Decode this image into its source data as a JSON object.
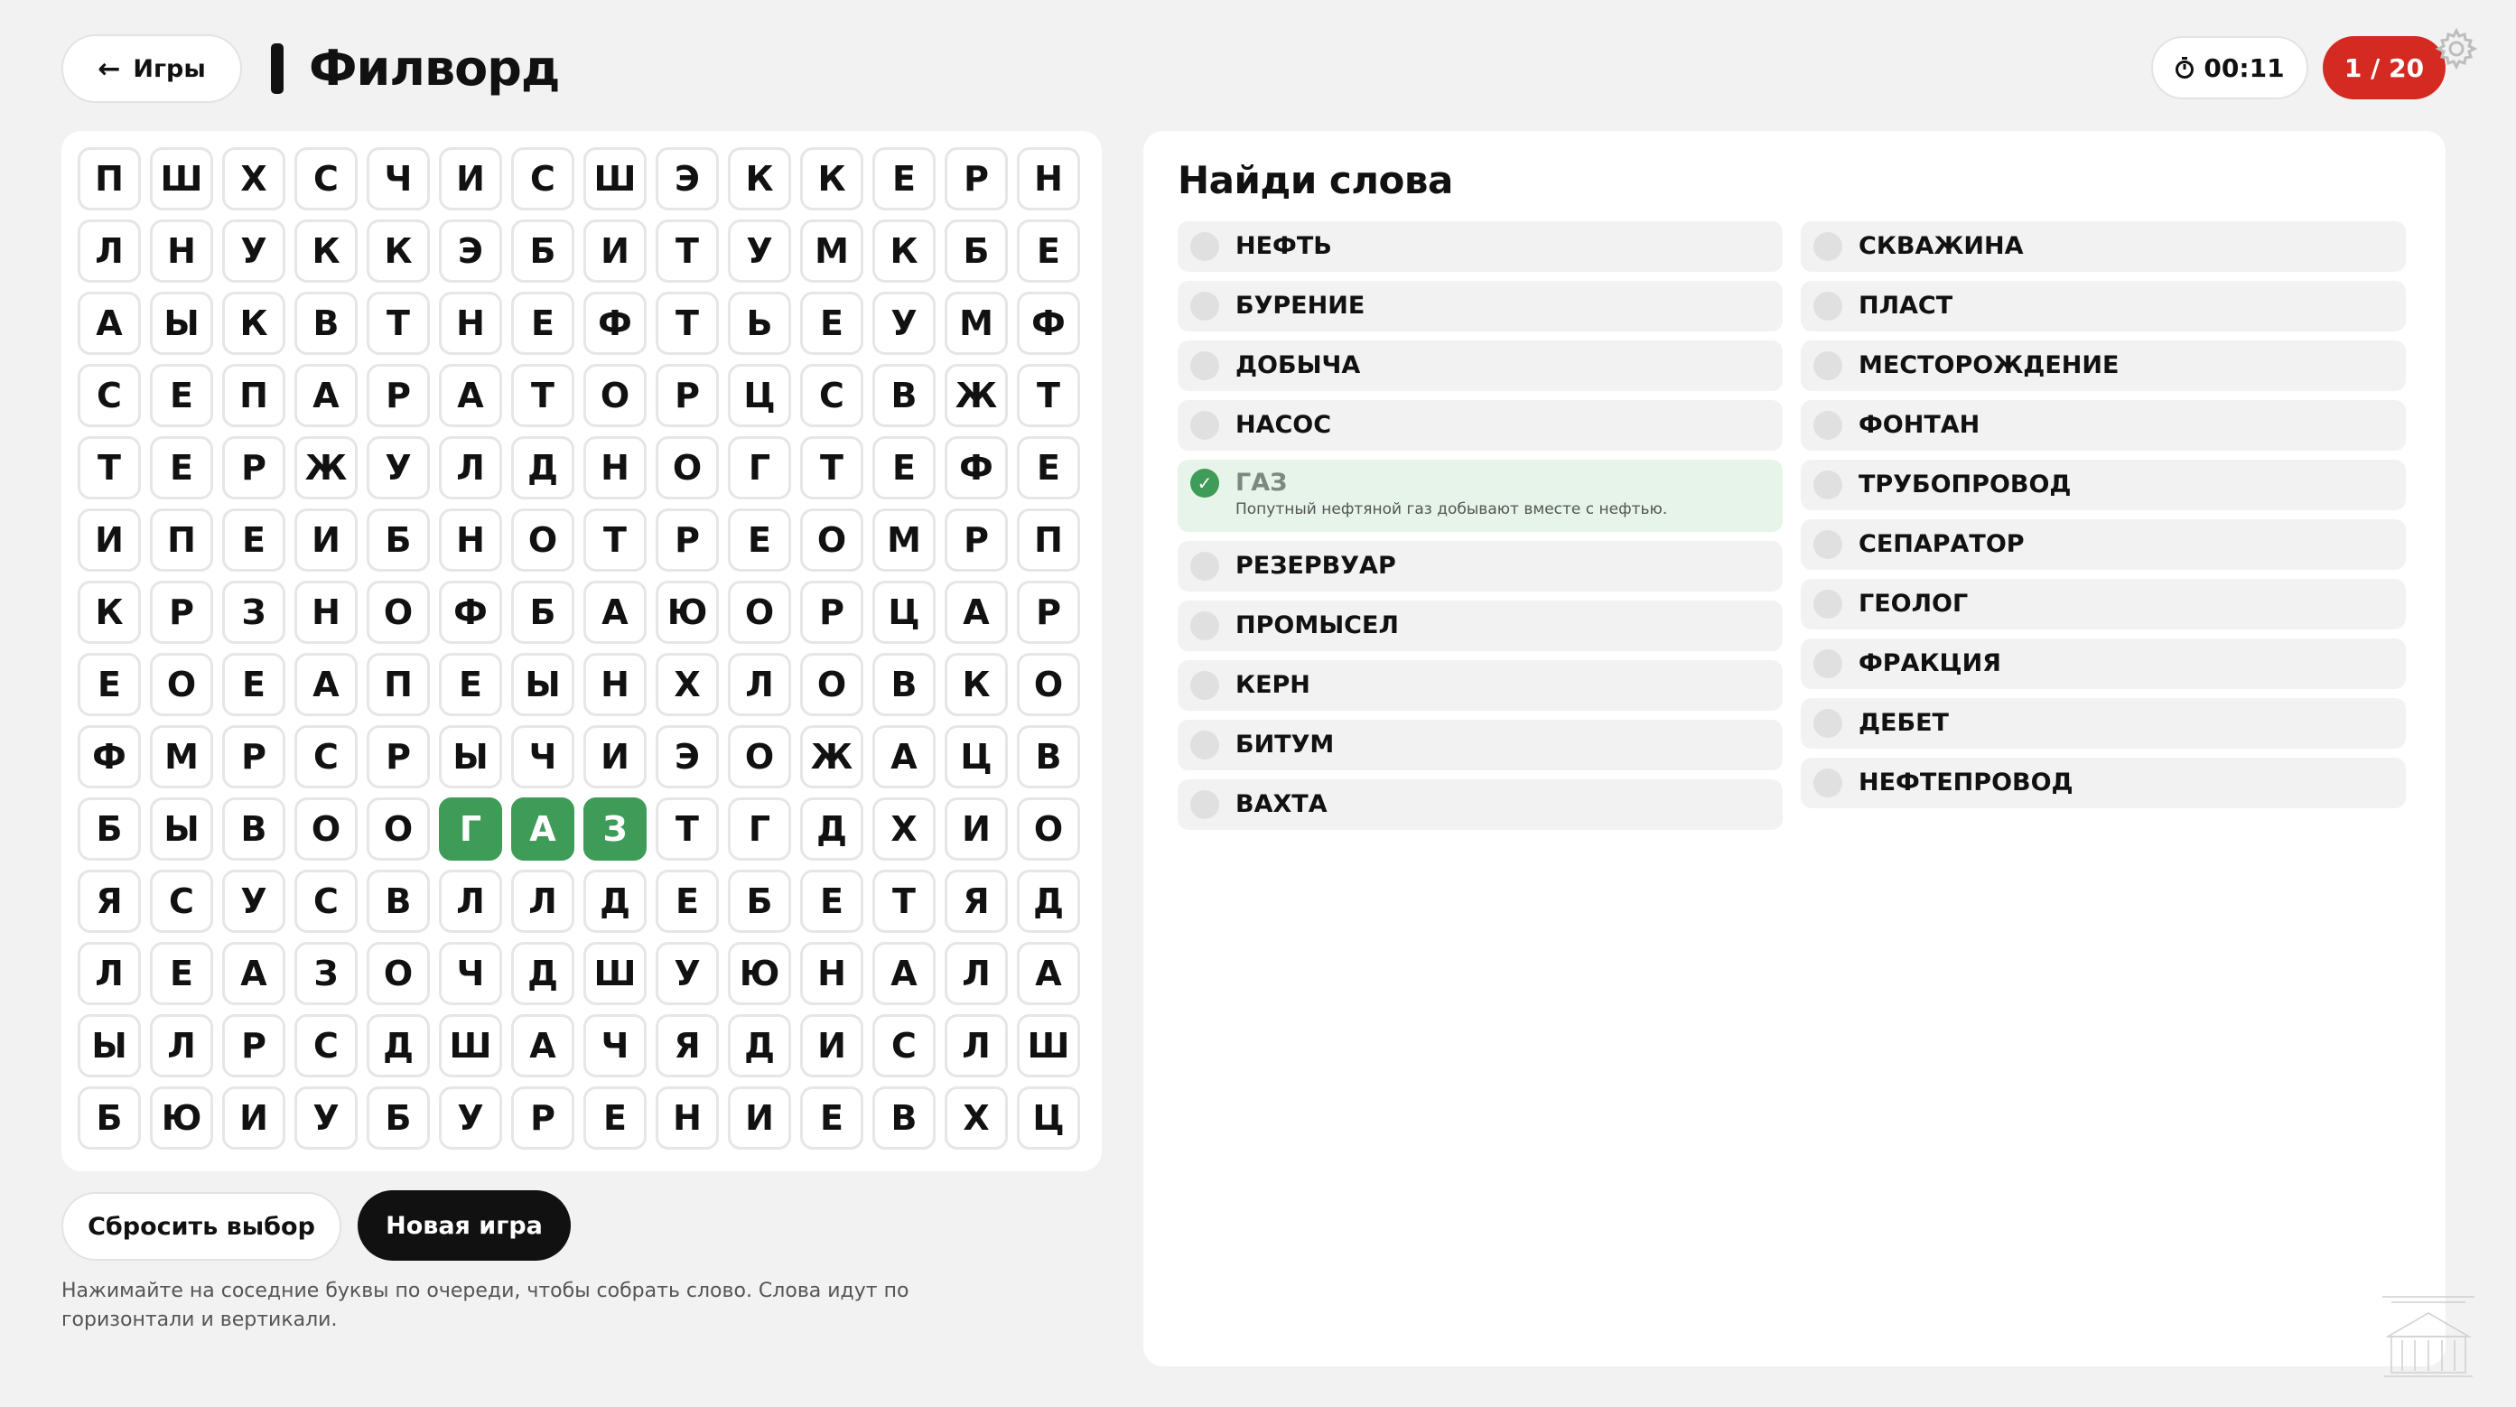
{
  "header": {
    "back_label": "Игры",
    "back_icon": "arrow-left-icon",
    "title": "Филворд",
    "timer_icon": "stopwatch-icon",
    "timer": "00:11",
    "counter": "1 / 20",
    "settings_icon": "gear-icon"
  },
  "grid": {
    "rows": [
      [
        "П",
        "Ш",
        "Х",
        "С",
        "Ч",
        "И",
        "С",
        "Ш",
        "Э",
        "К",
        "К",
        "Е",
        "Р",
        "Н"
      ],
      [
        "Л",
        "Н",
        "У",
        "К",
        "К",
        "Э",
        "Б",
        "И",
        "Т",
        "У",
        "М",
        "К",
        "Б",
        "Е"
      ],
      [
        "А",
        "Ы",
        "К",
        "В",
        "Т",
        "Н",
        "Е",
        "Ф",
        "Т",
        "Ь",
        "Е",
        "У",
        "М",
        "Ф"
      ],
      [
        "С",
        "Е",
        "П",
        "А",
        "Р",
        "А",
        "Т",
        "О",
        "Р",
        "Ц",
        "С",
        "В",
        "Ж",
        "Т"
      ],
      [
        "Т",
        "Е",
        "Р",
        "Ж",
        "У",
        "Л",
        "Д",
        "Н",
        "О",
        "Г",
        "Т",
        "Е",
        "Ф",
        "Е"
      ],
      [
        "И",
        "П",
        "Е",
        "И",
        "Б",
        "Н",
        "О",
        "Т",
        "Р",
        "Е",
        "О",
        "М",
        "Р",
        "П"
      ],
      [
        "К",
        "Р",
        "З",
        "Н",
        "О",
        "Ф",
        "Б",
        "А",
        "Ю",
        "О",
        "Р",
        "Ц",
        "А",
        "Р"
      ],
      [
        "Е",
        "О",
        "Е",
        "А",
        "П",
        "Е",
        "Ы",
        "Н",
        "Х",
        "Л",
        "О",
        "В",
        "К",
        "О"
      ],
      [
        "Ф",
        "М",
        "Р",
        "С",
        "Р",
        "Ы",
        "Ч",
        "И",
        "Э",
        "О",
        "Ж",
        "А",
        "Ц",
        "В"
      ],
      [
        "Б",
        "Ы",
        "В",
        "О",
        "О",
        "Г",
        "А",
        "З",
        "Т",
        "Г",
        "Д",
        "Х",
        "И",
        "О"
      ],
      [
        "Я",
        "С",
        "У",
        "С",
        "В",
        "Л",
        "Л",
        "Д",
        "Е",
        "Б",
        "Е",
        "Т",
        "Я",
        "Д"
      ],
      [
        "Л",
        "Е",
        "А",
        "З",
        "О",
        "Ч",
        "Д",
        "Ш",
        "У",
        "Ю",
        "Н",
        "А",
        "Л",
        "А"
      ],
      [
        "Ы",
        "Л",
        "Р",
        "С",
        "Д",
        "Ш",
        "А",
        "Ч",
        "Я",
        "Д",
        "И",
        "С",
        "Л",
        "Ш"
      ],
      [
        "Б",
        "Ю",
        "И",
        "У",
        "Б",
        "У",
        "Р",
        "Е",
        "Н",
        "И",
        "Е",
        "В",
        "Х",
        "Ц"
      ]
    ],
    "found_cells": [
      [
        9,
        5
      ],
      [
        9,
        6
      ],
      [
        9,
        7
      ]
    ]
  },
  "controls": {
    "reset_label": "Сбросить выбор",
    "new_game_label": "Новая игра",
    "hint": "Нажимайте на соседние буквы по очереди, чтобы собрать слово. Слова идут по горизонтали и вертикали."
  },
  "words_panel": {
    "title": "Найди слова",
    "left": [
      {
        "label": "НЕФТЬ"
      },
      {
        "label": "БУРЕНИЕ"
      },
      {
        "label": "ДОБЫЧА"
      },
      {
        "label": "НАСОС"
      },
      {
        "label": "ГАЗ",
        "found": true,
        "note": "Попутный нефтяной газ добывают вместе с нефтью."
      },
      {
        "label": "РЕЗЕРВУАР"
      },
      {
        "label": "ПРОМЫСЕЛ"
      },
      {
        "label": "КЕРН"
      },
      {
        "label": "БИТУМ"
      },
      {
        "label": "ВАХТА"
      }
    ],
    "right": [
      {
        "label": "СКВАЖИНА"
      },
      {
        "label": "ПЛАСТ"
      },
      {
        "label": "МЕСТОРОЖДЕНИЕ"
      },
      {
        "label": "ФОНТАН"
      },
      {
        "label": "ТРУБОПРОВОД"
      },
      {
        "label": "СЕПАРАТОР"
      },
      {
        "label": "ГЕОЛОГ"
      },
      {
        "label": "ФРАКЦИЯ"
      },
      {
        "label": "ДЕБЕТ"
      },
      {
        "label": "НЕФТЕПРОВОД"
      }
    ]
  },
  "colors": {
    "accent_red": "#d42a22",
    "found_green": "#3e9b58",
    "found_bg": "#e6f4e9"
  }
}
